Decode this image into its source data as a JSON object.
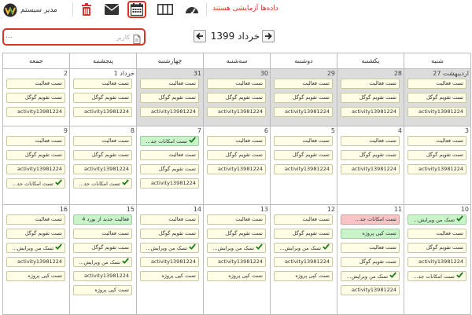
{
  "toolbar": {
    "user_label": "مدیر سیستم",
    "title": "داده‌ها آزمایشی هستند"
  },
  "search": {
    "placeholder": "کاربر",
    "more_label": "..."
  },
  "calendar": {
    "month_title": "خرداد 1399",
    "weekdays": [
      "شنبه",
      "یکشنبه",
      "دوشنبه",
      "سه‌شنبه",
      "چهارشنبه",
      "پنجشنبه",
      "جمعه"
    ],
    "weeks": [
      [
        {
          "day": "27 اردیبهشت",
          "past": true,
          "events": [
            {
              "t": "تست فعالیت"
            },
            {
              "t": "تست تقویم گوگل"
            },
            {
              "t": "activity13981224"
            }
          ]
        },
        {
          "day": "28",
          "past": true,
          "events": [
            {
              "t": "تست فعالیت"
            },
            {
              "t": "تست تقویم گوگل"
            },
            {
              "t": "activity13981224"
            }
          ]
        },
        {
          "day": "29",
          "past": true,
          "events": [
            {
              "t": "تست فعالیت"
            },
            {
              "t": "تست تقویم گوگل"
            },
            {
              "t": "activity13981224"
            }
          ]
        },
        {
          "day": "30",
          "past": true,
          "events": [
            {
              "t": "تست فعالیت"
            },
            {
              "t": "تست تقویم گوگل"
            },
            {
              "t": "activity13981224"
            }
          ]
        },
        {
          "day": "31",
          "past": true,
          "events": [
            {
              "t": "تست فعالیت"
            },
            {
              "t": "تست تقویم گوگل"
            },
            {
              "t": "activity13981224"
            }
          ]
        },
        {
          "day": "1 خرداد",
          "past": false,
          "events": [
            {
              "t": "تست فعالیت"
            },
            {
              "t": "تست تقویم گوگل"
            },
            {
              "t": "activity13981224"
            }
          ]
        },
        {
          "day": "2",
          "past": false,
          "events": [
            {
              "t": "تست فعالیت"
            },
            {
              "t": "تست تقویم گوگل"
            },
            {
              "t": "activity13981224"
            }
          ]
        }
      ],
      [
        {
          "day": "3",
          "past": false,
          "events": [
            {
              "t": "تست فعالیت"
            },
            {
              "t": "تست تقویم گوگل"
            },
            {
              "t": "activity13981224"
            }
          ]
        },
        {
          "day": "4",
          "past": false,
          "events": [
            {
              "t": "تست فعالیت"
            },
            {
              "t": "تست تقویم گوگل"
            },
            {
              "t": "activity13981224"
            }
          ]
        },
        {
          "day": "5",
          "past": false,
          "events": [
            {
              "t": "تست فعالیت"
            },
            {
              "t": "تست تقویم گوگل"
            },
            {
              "t": "activity13981224"
            }
          ]
        },
        {
          "day": "6",
          "past": false,
          "events": [
            {
              "t": "تست فعالیت"
            },
            {
              "t": "تست تقویم گوگل"
            },
            {
              "t": "activity13981224"
            }
          ]
        },
        {
          "day": "7",
          "past": false,
          "events": [
            {
              "t": "تست امکانات جد...",
              "c": "green",
              "check": true
            },
            {
              "t": "تست فعالیت"
            },
            {
              "t": "تست تقویم گوگل"
            },
            {
              "t": "activity13981224"
            }
          ]
        },
        {
          "day": "8",
          "past": false,
          "events": [
            {
              "t": "تست فعالیت"
            },
            {
              "t": "تست تقویم گوگل"
            },
            {
              "t": "activity13981224"
            },
            {
              "t": "تست امکانات جد...",
              "check": true
            }
          ]
        },
        {
          "day": "9",
          "past": false,
          "events": [
            {
              "t": "تست فعالیت"
            },
            {
              "t": "تست تقویم گوگل"
            },
            {
              "t": "activity13981224"
            },
            {
              "t": "تست امکانات جد...",
              "check": true
            }
          ]
        }
      ],
      [
        {
          "day": "10",
          "past": false,
          "events": [
            {
              "t": "تسک من ویرایش...",
              "c": "green",
              "check": true
            },
            {
              "t": "تست فعالیت"
            },
            {
              "t": "تست تقویم گوگل"
            },
            {
              "t": "activity13981224"
            },
            {
              "t": "تست امکانات جد...",
              "check": true
            }
          ]
        },
        {
          "day": "11",
          "past": false,
          "events": [
            {
              "t": "تست امکانات جد...",
              "c": "red"
            },
            {
              "t": "تست کپی پروژه",
              "c": "green"
            },
            {
              "t": "تست فعالیت"
            },
            {
              "t": "تست تقویم گوگل"
            },
            {
              "t": "تسک من ویرایش...",
              "check": true
            },
            {
              "t": "activity13981224"
            }
          ]
        },
        {
          "day": "12",
          "past": false,
          "events": [
            {
              "t": "تست فعالیت"
            },
            {
              "t": "تست تقویم گوگل"
            },
            {
              "t": "تسک من ویرایش...",
              "check": true
            },
            {
              "t": "activity13981224"
            },
            {
              "t": "تست کپی پروژه"
            }
          ]
        },
        {
          "day": "13",
          "past": false,
          "events": [
            {
              "t": "تست فعالیت"
            },
            {
              "t": "تست تقویم گوگل"
            },
            {
              "t": "تسک من ویرایش...",
              "check": true
            },
            {
              "t": "activity13981224"
            },
            {
              "t": "تست کپی پروژه"
            }
          ]
        },
        {
          "day": "14",
          "past": false,
          "events": [
            {
              "t": "تست فعالیت"
            },
            {
              "t": "تست تقویم گوگل"
            },
            {
              "t": "تسک من ویرایش...",
              "check": true
            },
            {
              "t": "activity13981224"
            },
            {
              "t": "تست کپی پروژه"
            }
          ]
        },
        {
          "day": "15",
          "past": false,
          "events": [
            {
              "t": "فعالیت جدید از بورد 4",
              "c": "green"
            },
            {
              "t": "تست فعالیت"
            },
            {
              "t": "تست تقویم گوگل"
            },
            {
              "t": "تسک من ویرایش...",
              "check": true
            },
            {
              "t": "activity13981224"
            },
            {
              "t": "تست کپی پروژه"
            }
          ]
        },
        {
          "day": "16",
          "past": false,
          "events": [
            {
              "t": "تست فعالیت"
            },
            {
              "t": "تست تقویم گوگل"
            },
            {
              "t": "تسک من ویرایش...",
              "check": true
            },
            {
              "t": "activity13981224"
            },
            {
              "t": "تست کپی پروژه"
            }
          ]
        }
      ]
    ]
  },
  "colors": {
    "accent": "#d9342b",
    "past_bg": "#dcdcdc",
    "event_bg": "#fffde6",
    "green_bg": "#c9f3c9",
    "red_bg": "#f6c5c5",
    "check": "#1a7a1a"
  }
}
